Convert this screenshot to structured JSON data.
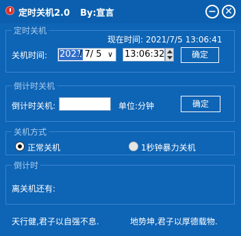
{
  "titlebar": {
    "title": "定时关机2.0",
    "author": "By:宣言",
    "minimize_glyph": "−",
    "close_glyph": "✕",
    "icon": "power-icon"
  },
  "timed_shutdown": {
    "group_label": "定时关机",
    "now_label": "现在时间: 2021/7/5 13:06:41",
    "shutdown_time_label": "关机时间:",
    "date_year": "2021",
    "date_rest": "/  7/  5",
    "date_dropdown_icon": "∨",
    "time_value": "13:06:32",
    "confirm_label": "确定"
  },
  "countdown_shutdown": {
    "group_label": "倒计时关机",
    "label": "倒计时关机:",
    "input_value": "",
    "unit_label": "单位:分钟",
    "confirm_label": "确定"
  },
  "shutdown_mode": {
    "group_label": "关机方式",
    "options": [
      {
        "label": "正常关机",
        "selected": true
      },
      {
        "label": "1秒钟暴力关机",
        "selected": false
      }
    ]
  },
  "countdown": {
    "group_label": "倒计时",
    "remaining_label": "离关机还有:"
  },
  "footer": {
    "left_text": "天行健,君子以自强不息.",
    "right_text": "地势坤,君子以厚德载物."
  }
}
